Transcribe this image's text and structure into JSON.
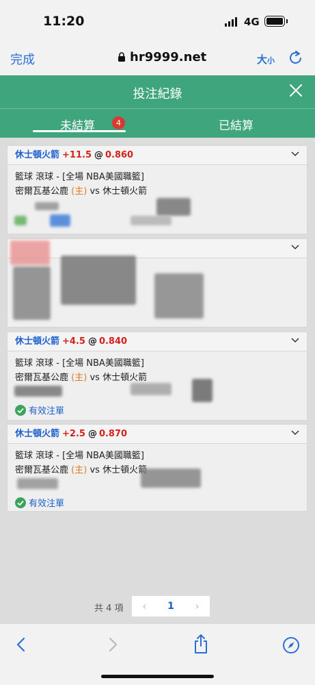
{
  "status_bar": {
    "time": "11:20",
    "network": "4G"
  },
  "browser": {
    "done_label": "完成",
    "url": "hr9999.net",
    "text_size_label": "大",
    "text_size_small": "小"
  },
  "modal": {
    "title": "投注紀錄"
  },
  "tabs": [
    {
      "label": "未結算",
      "badge": "4"
    },
    {
      "label": "已結算"
    }
  ],
  "bets": [
    {
      "team": "休士頓火箭",
      "handicap": "+11.5",
      "at": "@",
      "odds": "0.860",
      "sport": "籃球 滾球 - [全場 NBA美國職籃]",
      "home_team": "密爾瓦基公鹿",
      "home_tag": "(主)",
      "vs": "vs",
      "away_team": "休士頓火箭"
    },
    {
      "team": "休士頓火箭",
      "handicap": "+4.5",
      "at": "@",
      "odds": "0.840",
      "sport": "籃球 滾球 - [全場 NBA美國職籃]",
      "home_team": "密爾瓦基公鹿",
      "home_tag": "(主)",
      "vs": "vs",
      "away_team": "休士頓火箭",
      "status": "有效注單"
    },
    {
      "team": "休士頓火箭",
      "handicap": "+2.5",
      "at": "@",
      "odds": "0.870",
      "sport": "籃球 滾球 - [全場 NBA美國職籃]",
      "home_team": "密爾瓦基公鹿",
      "home_tag": "(主)",
      "vs": "vs",
      "away_team": "休士頓火箭",
      "status": "有效注單"
    }
  ],
  "pagination": {
    "total": "共 4 項",
    "prev": "‹",
    "current": "1",
    "next": "›"
  },
  "colors": {
    "header_green": "#3fa57c",
    "link_blue": "#1c5fcc",
    "odds_red": "#d3231c",
    "home_orange": "#e07a1f",
    "badge_red": "#d93a2f"
  }
}
